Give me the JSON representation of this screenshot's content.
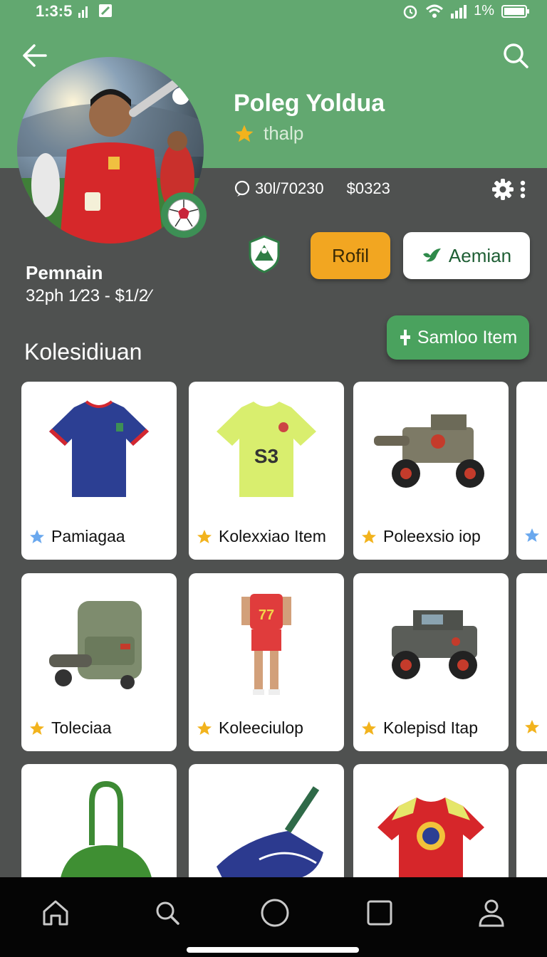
{
  "status_bar": {
    "time": "1:3:5",
    "battery": "1%"
  },
  "profile": {
    "name": "Poleg Yoldua",
    "rating_label": "thalp",
    "stat_followers": "30l/70230",
    "stat_value": "$0323",
    "role": "Pemnain",
    "info": "32ph 1⁄23 - $1/2⁄"
  },
  "actions": {
    "profil_label": "Rofil",
    "follow_label": "Aemian",
    "add_item_label": "Samloo Item"
  },
  "section": {
    "title": "Kolesidiuan"
  },
  "items": [
    {
      "label": "Pamiagaa",
      "star": "blue",
      "icon": "jersey-blue-icon"
    },
    {
      "label": "Kolexxiao Item",
      "star": "gold",
      "icon": "jersey-yellow-icon"
    },
    {
      "label": "Poleexsio iop",
      "star": "gold",
      "icon": "cannon-vehicle-icon"
    },
    {
      "label": "",
      "star": "blue",
      "icon": "vehicle-icon"
    },
    {
      "label": "Toleciaa",
      "star": "gold",
      "icon": "backpack-icon"
    },
    {
      "label": "Koleeciulop",
      "star": "gold",
      "icon": "player-figure-icon"
    },
    {
      "label": "Kolepisd Itap",
      "star": "gold",
      "icon": "jeep-icon"
    },
    {
      "label": "",
      "star": "gold",
      "icon": "figure-icon"
    },
    {
      "label": "",
      "star": "",
      "icon": "green-bag-icon"
    },
    {
      "label": "",
      "star": "",
      "icon": "blue-bag-icon"
    },
    {
      "label": "",
      "star": "",
      "icon": "red-shirt-icon"
    },
    {
      "label": "",
      "star": "",
      "icon": "item-icon"
    }
  ],
  "nav": [
    "home-icon",
    "search-icon",
    "circle-icon",
    "square-icon",
    "profile-icon"
  ],
  "colors": {
    "header": "#62a870",
    "body": "#4f5150",
    "accent_orange": "#f2a621",
    "accent_green": "#4aa25e"
  }
}
